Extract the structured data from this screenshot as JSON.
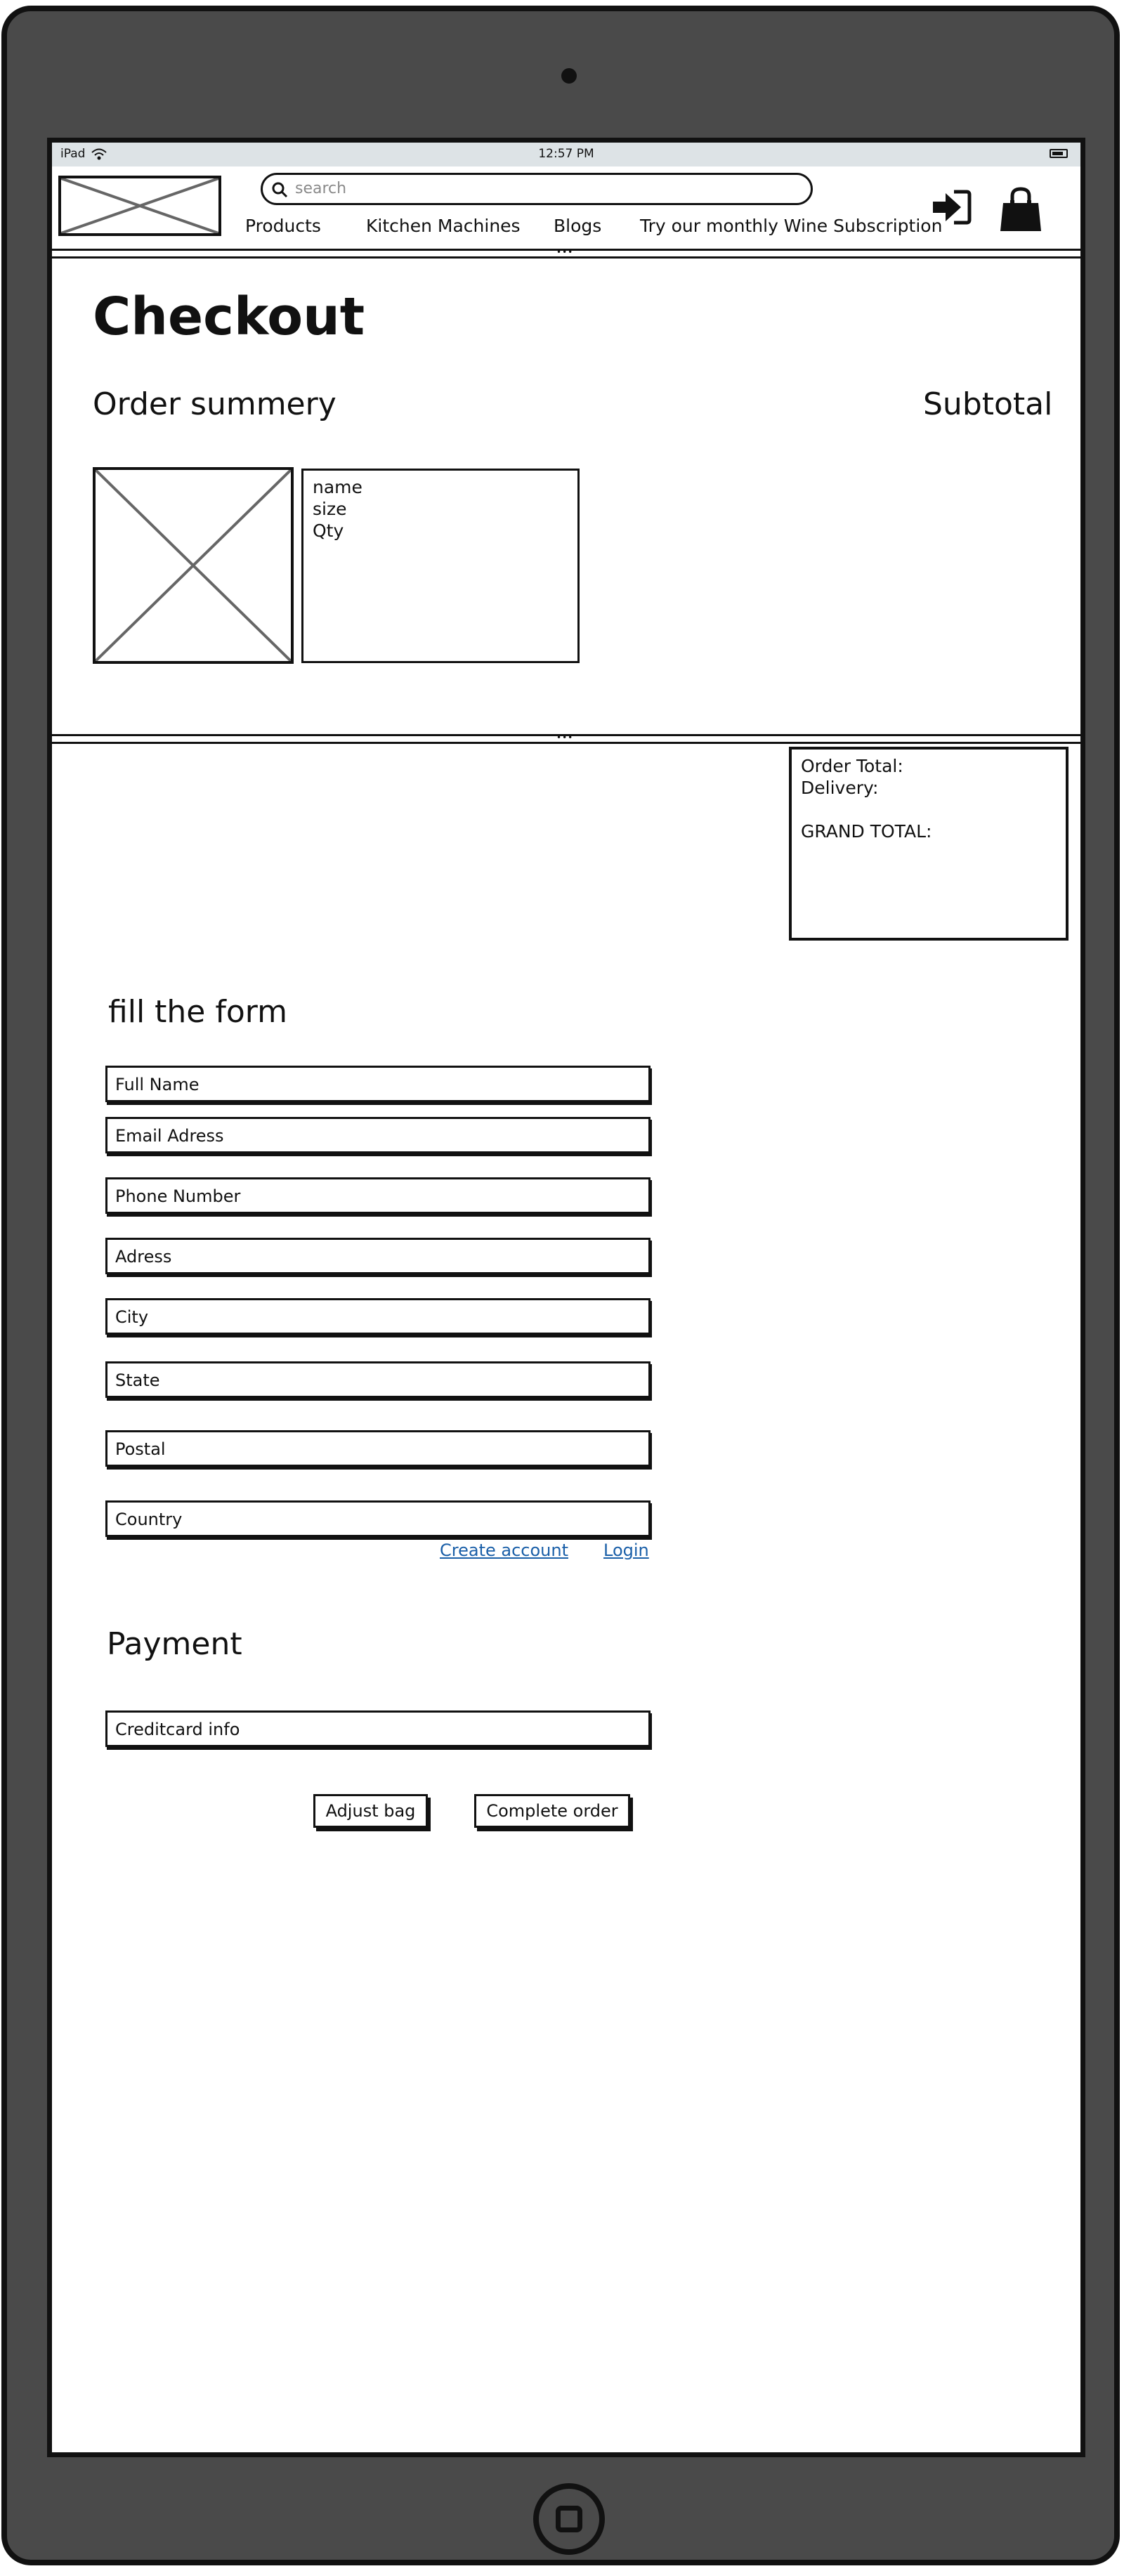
{
  "status_bar": {
    "device": "iPad",
    "time": "12:57 PM"
  },
  "header": {
    "search": {
      "placeholder": "search"
    },
    "nav": [
      "Products",
      "Kitchen Machines",
      "Blogs",
      "Try our monthly Wine Subscription"
    ]
  },
  "checkout": {
    "title": "Checkout",
    "order_summary": "Order summery",
    "subtotal": "Subtotal",
    "product": {
      "lines": [
        "name",
        "size",
        "Qty"
      ]
    }
  },
  "totals": {
    "order_total": "Order Total:",
    "delivery": "Delivery:",
    "grand_total": "GRAND TOTAL:"
  },
  "form": {
    "title": "fill the form",
    "fields": [
      "Full Name",
      "Email Adress",
      "Phone Number",
      "Adress",
      "City",
      "State",
      "Postal",
      "Country"
    ],
    "links": {
      "create_account": "Create account",
      "login": "Login"
    }
  },
  "payment": {
    "title": "Payment",
    "creditcard": "Creditcard info",
    "buttons": {
      "adjust_bag": "Adjust bag",
      "complete_order": "Complete order"
    }
  },
  "colors": {
    "frame": "#4a4a4a",
    "link": "#1a5fa8",
    "status_bar": "#dde3e6"
  },
  "icons": [
    "wifi-icon",
    "battery-icon",
    "search-icon",
    "login-icon",
    "shopping-bag-icon",
    "image-placeholder-icon"
  ]
}
